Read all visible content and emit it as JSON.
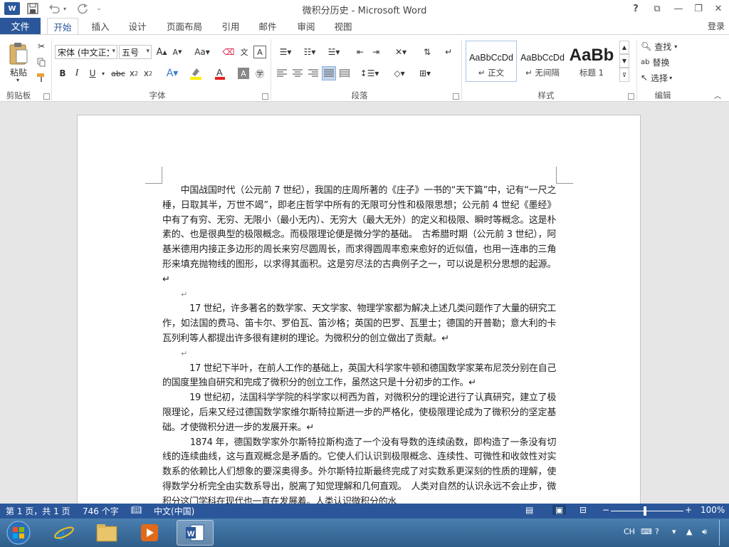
{
  "window": {
    "title": "微积分历史 - Microsoft Word",
    "app_icon": "W"
  },
  "title_controls": {
    "help": "?",
    "restore_ribbon": "⧉",
    "minimize": "—",
    "maximize": "❐",
    "close": "✕"
  },
  "tabs": {
    "file": "文件",
    "items": [
      "开始",
      "插入",
      "设计",
      "页面布局",
      "引用",
      "邮件",
      "审阅",
      "视图"
    ],
    "active": "开始",
    "login": "登录"
  },
  "ribbon": {
    "clipboard": {
      "label": "剪贴板",
      "paste": "粘贴"
    },
    "font": {
      "label": "字体",
      "font_name": "宋体 (中文正文",
      "font_size": "五号"
    },
    "paragraph": {
      "label": "段落"
    },
    "styles": {
      "label": "样式",
      "items": [
        {
          "preview": "AaBbCcDd",
          "name": "↵ 正文"
        },
        {
          "preview": "AaBbCcDd",
          "name": "↵ 无间隔"
        },
        {
          "preview": "AaBb",
          "name": "标题 1"
        }
      ]
    },
    "editing": {
      "label": "编辑",
      "find": "查找",
      "replace": "替换",
      "select": "选择"
    }
  },
  "document": {
    "paragraphs": [
      "　　中国战国时代（公元前 7 世纪），我国的庄周所著的《庄子》一书的“天下篇”中，记有“一尺之棰，日取其半，万世不竭”，即老庄哲学中所有的无限可分性和极限思想；公元前 4 世纪《墨经》中有了有穷、无穷、无限小（最小无内）、无穷大（最大无外）的定义和极限、瞬时等概念。这是朴素的、也是很典型的极限概念。而极限理论便是微分学的基础。　古希腊时期（公元前 3 世纪），阿基米德用内接正多边形的周长来穷尽圆周长，而求得圆周率愈来愈好的近似值，也用一连串的三角形来填充抛物线的图形，以求得其面积。这是穷尽法的古典例子之一，可以说是积分思想的起源。↵",
      "↵",
      "　　　17 世纪，许多著名的数学家、天文学家、物理学家都为解决上述几类问题作了大量的研究工作，如法国的费马、笛卡尔、罗伯瓦、笛沙格；英国的巴罗、瓦里士；德国的开普勒；意大利的卡瓦列利等人都提出许多很有建树的理论。为微积分的创立做出了贡献。↵",
      "↵",
      "　　　17 世纪下半叶，在前人工作的基础上，英国大科学家牛顿和德国数学家莱布尼茨分别在自己的国度里独自研究和完成了微积分的创立工作，虽然这只是十分初步的工作。↵",
      "　　　19 世纪初，法国科学学院的科学家以柯西为首，对微积分的理论进行了认真研究，建立了极限理论，后来又经过德国数学家维尔斯特拉斯进一步的严格化，使极限理论成为了微积分的坚定基础。才使微积分进一步的发展开来。↵",
      "　　　1874 年，德国数学家外尔斯特拉斯构造了一个没有导数的连续函数，即构造了一条没有切线的连续曲线，这与直观概念是矛盾的。它使人们认识到极限概念、连续性、可微性和收敛性对实数系的依赖比人们想象的要深奥得多。外尔斯特拉斯最终完成了对实数系更深刻的性质的理解，使得数学分析完全由实数系导出，脱离了知觉理解和几何直观。　人类对自然的认识永远不会止步，微积分这门学科在现代也一直在发展着。人类认识微积分的水"
    ]
  },
  "status": {
    "page": "第 1 页，共 1 页",
    "words": "746 个字",
    "lang": "中文(中国)",
    "zoom": "100%"
  },
  "taskbar": {
    "ime": "CH"
  }
}
